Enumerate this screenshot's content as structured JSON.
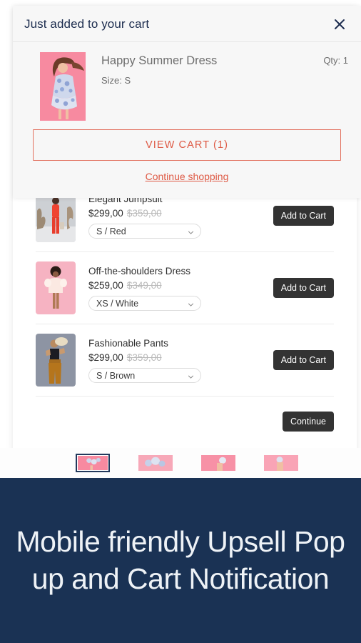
{
  "theme": {
    "accent_red": "#de5a45",
    "dark_button": "#333333",
    "banner_navy": "#1a3254",
    "notification_bg": "#f7f7f7"
  },
  "cart_notification": {
    "title": "Just added to your cart",
    "close_icon": "close-icon",
    "product": {
      "name": "Happy Summer Dress",
      "variant_label": "Size: S",
      "qty_label": "Qty: 1"
    },
    "view_cart_label": "VIEW CART (1)",
    "continue_shopping_label": "Continue shopping"
  },
  "upsell": {
    "products": [
      {
        "name": "Elegant Jumpsuit",
        "price": "$299,00",
        "compare_price": "$359,00",
        "variant": "S / Red",
        "add_label": "Add to Cart"
      },
      {
        "name": "Off-the-shoulders Dress",
        "price": "$259,00",
        "compare_price": "$349,00",
        "variant": "XS / White",
        "add_label": "Add to Cart"
      },
      {
        "name": "Fashionable Pants",
        "price": "$299,00",
        "compare_price": "$359,00",
        "variant": "S / Brown",
        "add_label": "Add to Cart"
      }
    ],
    "continue_label": "Continue"
  },
  "banner": {
    "headline": "Mobile friendly Upsell Pop up and Cart Notification"
  }
}
